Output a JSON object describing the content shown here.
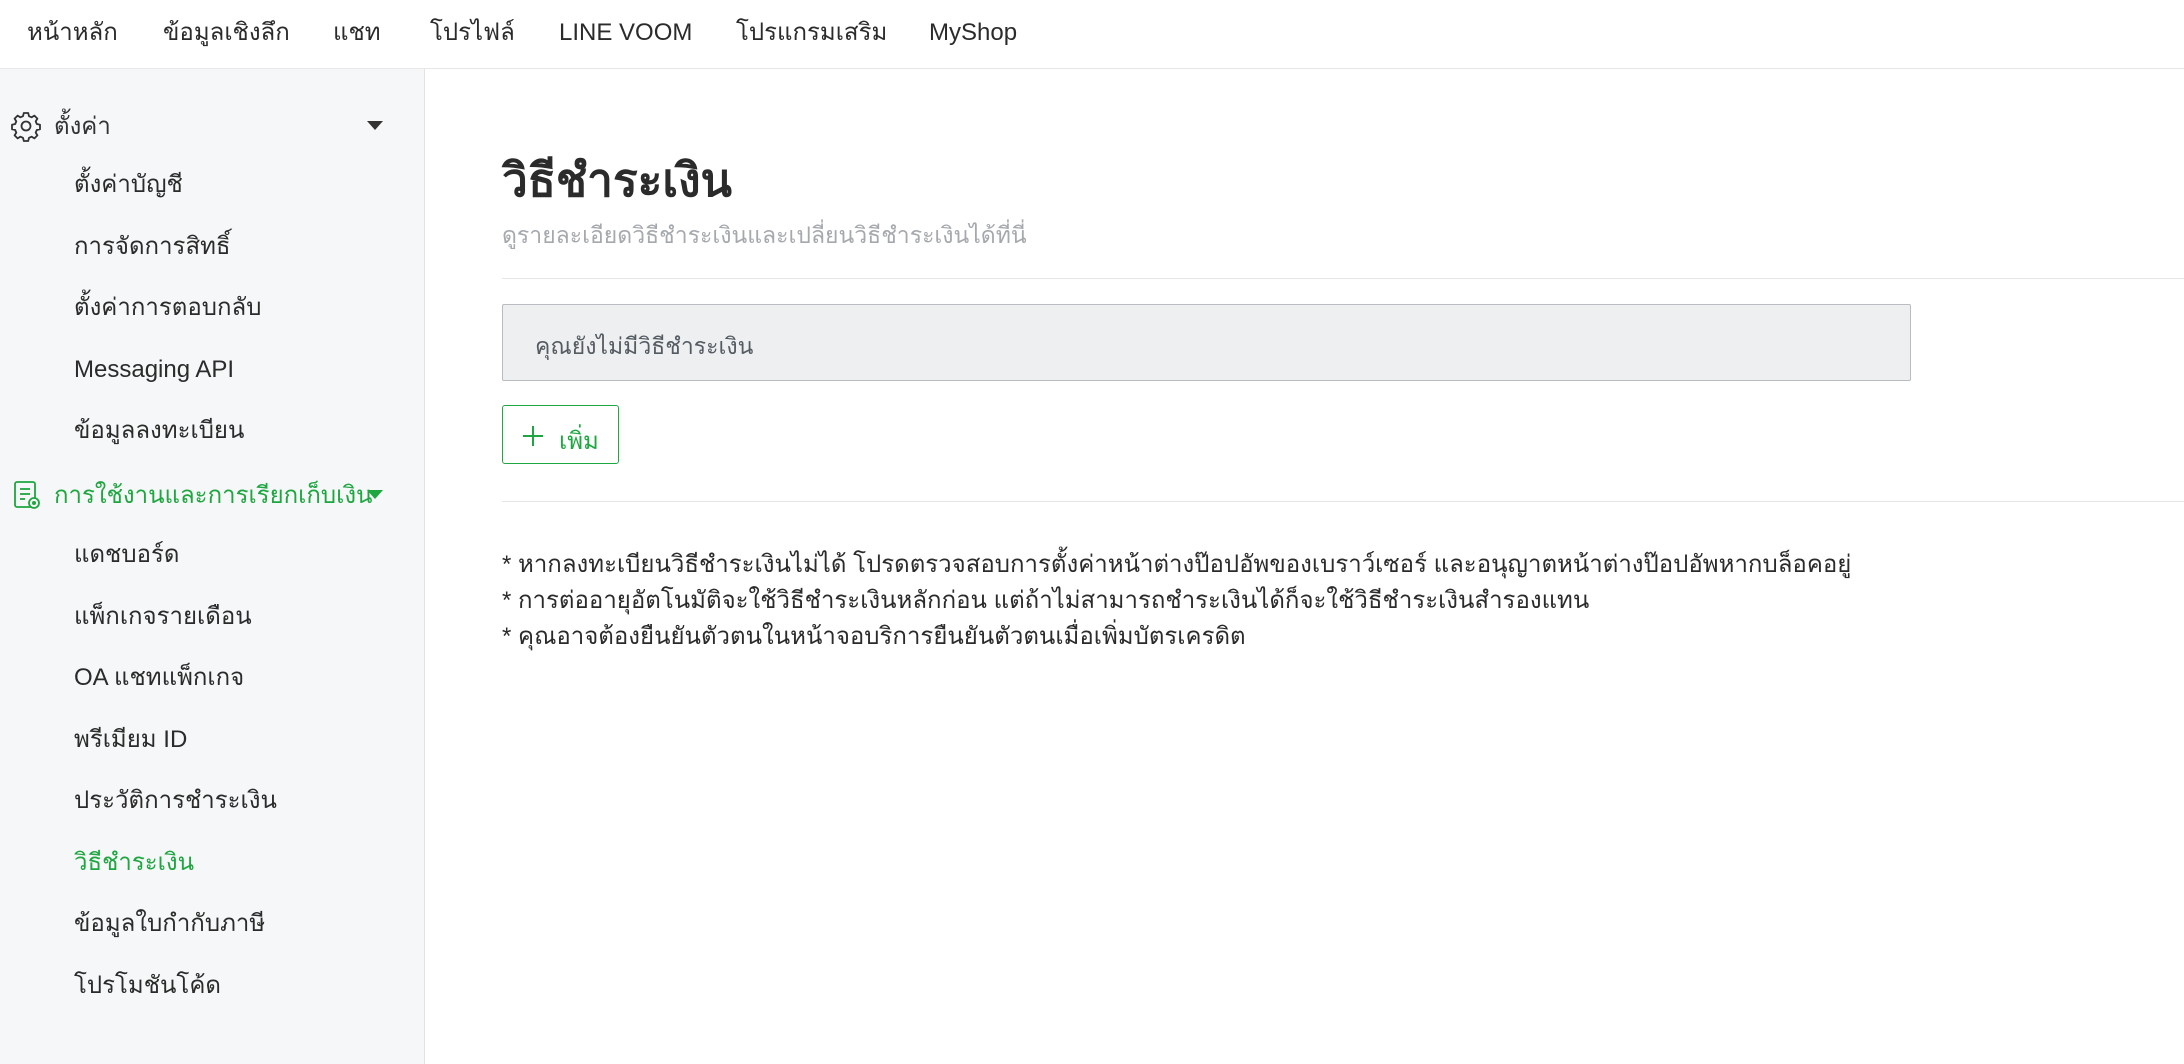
{
  "topnav": {
    "items": [
      "หน้าหลัก",
      "ข้อมูลเชิงลึก",
      "แชท",
      "โปรไฟล์",
      "LINE VOOM",
      "โปรแกรมเสริม",
      "MyShop"
    ]
  },
  "sidebar": {
    "settings": {
      "icon": "gear-icon",
      "label": "ตั้งค่า",
      "items": [
        "ตั้งค่าบัญชี",
        "การจัดการสิทธิ์",
        "ตั้งค่าการตอบกลับ",
        "Messaging API",
        "ข้อมูลลงทะเบียน"
      ]
    },
    "billing": {
      "icon": "document-icon",
      "label": "การใช้งานและการเรียกเก็บเงิน",
      "items": [
        "แดชบอร์ด",
        "แพ็กเกจรายเดือน",
        "OA แชทแพ็กเกจ",
        "พรีเมียม ID",
        "ประวัติการชำระเงิน",
        "วิธีชำระเงิน",
        "ข้อมูลใบกำกับภาษี",
        "โปรโมชันโค้ด"
      ],
      "active": "วิธีชำระเงิน"
    }
  },
  "main": {
    "title": "วิธีชำระเงิน",
    "subtitle": "ดูรายละเอียดวิธีชำระเงินและเปลี่ยนวิธีชำระเงินได้ที่นี่",
    "empty_message": "คุณยังไม่มีวิธีชำระเงิน",
    "add_button": "เพิ่ม",
    "notes": [
      "* หากลงทะเบียนวิธีชำระเงินไม่ได้ โปรดตรวจสอบการตั้งค่าหน้าต่างป๊อปอัพของเบราว์เซอร์ และอนุญาตหน้าต่างป๊อปอัพหากบล็อคอยู่",
      "* การต่ออายุอัตโนมัติจะใช้วิธีชำระเงินหลักก่อน แต่ถ้าไม่สามารถชำระเงินได้ก็จะใช้วิธีชำระเงินสำรองแทน",
      "* คุณอาจต้องยืนยันตัวตนในหน้าจอบริการยืนยันตัวตนเมื่อเพิ่มบัตรเครดิต"
    ]
  },
  "colors": {
    "accent": "#1ea640",
    "sidebar_bg": "#f6f7f8",
    "empty_box_bg": "#eeeff1",
    "subtitle": "#a5a9ae"
  }
}
